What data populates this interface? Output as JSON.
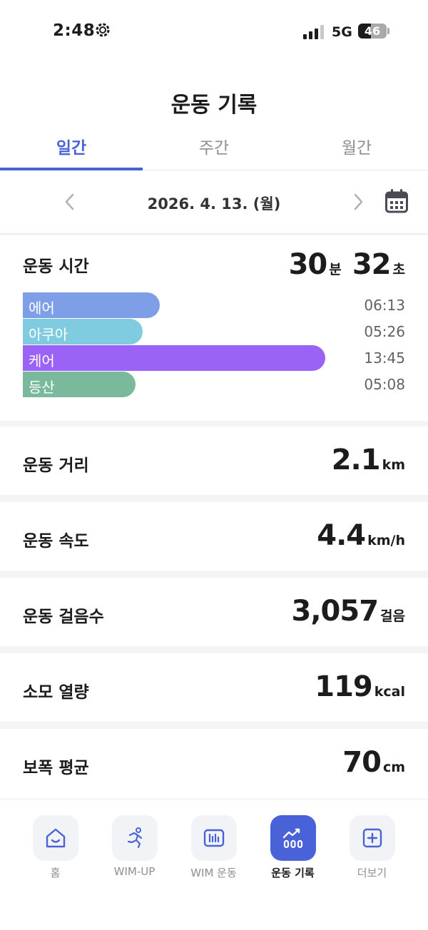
{
  "status": {
    "time": "2:48",
    "network": "5G",
    "battery": "46",
    "battery_level": 0.46
  },
  "header": {
    "title": "운동 기록",
    "tabs": [
      {
        "label": "일간",
        "active": true
      },
      {
        "label": "주간",
        "active": false
      },
      {
        "label": "월간",
        "active": false
      }
    ],
    "date": "2026. 4. 13. (월)"
  },
  "exercise_time": {
    "label": "운동 시간",
    "minutes": "30",
    "minutes_unit": "분",
    "seconds": "32",
    "seconds_unit": "초",
    "breakdown": [
      {
        "name": "에어",
        "duration": "06:13",
        "seconds": 373,
        "color": "#7e9fe8"
      },
      {
        "name": "아쿠아",
        "duration": "05:26",
        "seconds": 326,
        "color": "#7fcbe0"
      },
      {
        "name": "케어",
        "duration": "13:45",
        "seconds": 825,
        "color": "#9b63f5"
      },
      {
        "name": "등산",
        "duration": "05:08",
        "seconds": 308,
        "color": "#7ab99c"
      }
    ]
  },
  "metrics": [
    {
      "label": "운동 거리",
      "value": "2.1",
      "unit": "km"
    },
    {
      "label": "운동 속도",
      "value": "4.4",
      "unit": "km/h"
    },
    {
      "label": "운동 걸음수",
      "value": "3,057",
      "unit": "걸음"
    },
    {
      "label": "소모 열량",
      "value": "119",
      "unit": "kcal"
    },
    {
      "label": "보폭 평균",
      "value": "70",
      "unit": "cm"
    }
  ],
  "bottom_nav": [
    {
      "label": "홈",
      "icon": "home-icon",
      "active": false
    },
    {
      "label": "WIM-UP",
      "icon": "running-icon",
      "active": false
    },
    {
      "label": "WIM 운동",
      "icon": "chart-icon",
      "active": false
    },
    {
      "label": "운동 기록",
      "icon": "trend-icon",
      "active": true
    },
    {
      "label": "더보기",
      "icon": "plus-square-icon",
      "active": false
    }
  ],
  "colors": {
    "accent": "#4a62d8"
  }
}
